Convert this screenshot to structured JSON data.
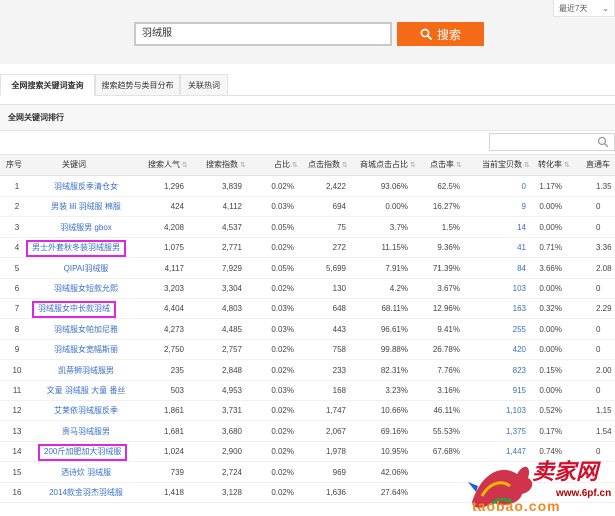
{
  "header": {
    "period": "最近7天",
    "search_value": "羽绒服",
    "search_button": "搜索"
  },
  "tabs": [
    {
      "label": "全网搜索关键词查询",
      "active": true
    },
    {
      "label": "搜索趋势与类目分布",
      "active": false
    },
    {
      "label": "关联热词",
      "active": false
    }
  ],
  "panel": {
    "title": "全网关键词排行"
  },
  "table": {
    "columns": [
      "序号",
      "关键词",
      "搜索人气",
      "搜索指数",
      "占比",
      "点击指数",
      "商城点击占比",
      "点击率",
      "当前宝贝数",
      "转化率",
      "直通车"
    ],
    "rows": [
      [
        "1",
        "羽绒服反季清仓女",
        "1,296",
        "3,839",
        "0.02%",
        "2,422",
        "93.06%",
        "62.5%",
        "0",
        "1.17%",
        "1.35"
      ],
      [
        "2",
        "男装 lili 羽绒服 棉服",
        "424",
        "4,112",
        "0.03%",
        "694",
        "0.00%",
        "16.27%",
        "9",
        "0.00%",
        "0"
      ],
      [
        "3",
        "羽绒服男 gbox",
        "4,208",
        "4,537",
        "0.05%",
        "75",
        "3.7%",
        "1.5%",
        "14",
        "0.00%",
        "0"
      ],
      [
        "4",
        "男士外套秋冬装羽绒服男",
        "1,075",
        "2,771",
        "0.02%",
        "272",
        "11.15%",
        "9.36%",
        "41",
        "0.71%",
        "3.36"
      ],
      [
        "5",
        "QIPAI羽绒服",
        "4,117",
        "7,929",
        "0.05%",
        "5,699",
        "7.91%",
        "71.39%",
        "84",
        "3.66%",
        "2.08"
      ],
      [
        "6",
        "羽绒服女短款允熙",
        "3,203",
        "3,304",
        "0.02%",
        "130",
        "4.2%",
        "3.67%",
        "103",
        "0.00%",
        "0"
      ],
      [
        "7",
        "羽绒服女中长款羽绒",
        "4,404",
        "4,803",
        "0.03%",
        "648",
        "68.11%",
        "12.96%",
        "163",
        "0.32%",
        "2.29"
      ],
      [
        "8",
        "羽绒服女帕加尼雅",
        "4,273",
        "4,485",
        "0.03%",
        "443",
        "96.61%",
        "9.41%",
        "255",
        "0.00%",
        "0"
      ],
      [
        "9",
        "羽绒服女宽幅斯丽",
        "2,750",
        "2,757",
        "0.02%",
        "758",
        "99.88%",
        "26.78%",
        "420",
        "0.00%",
        "0"
      ],
      [
        "10",
        "凯蒂狮羽绒服男",
        "235",
        "2,848",
        "0.02%",
        "233",
        "82.31%",
        "7.76%",
        "823",
        "0.15%",
        "2.00"
      ],
      [
        "11",
        "文童 羽绒服 大童 番丝",
        "503",
        "4,953",
        "0.03%",
        "168",
        "3.23%",
        "3.16%",
        "915",
        "0.00%",
        "0"
      ],
      [
        "12",
        "艾莱依羽绒服反季",
        "1,861",
        "3,731",
        "0.02%",
        "1,747",
        "10.66%",
        "46.11%",
        "1,103",
        "0.52%",
        "1.15"
      ],
      [
        "13",
        "贵马羽绒服男",
        "1,681",
        "3,680",
        "0.02%",
        "2,067",
        "69.16%",
        "55.53%",
        "1,375",
        "0.17%",
        "1.54"
      ],
      [
        "14",
        "200斤加肥加大羽绒服",
        "1,024",
        "2,900",
        "0.02%",
        "1,978",
        "10.95%",
        "67.68%",
        "1,447",
        "0.74%",
        "0"
      ],
      [
        "15",
        "洒诗炊 羽绒服",
        "739",
        "2,724",
        "0.02%",
        "969",
        "42.06%",
        "",
        "",
        "",
        ""
      ],
      [
        "16",
        "2014款金羽杰羽绒服",
        "1,418",
        "3,128",
        "0.02%",
        "1,636",
        "27.64%",
        "",
        "",
        "",
        ""
      ]
    ],
    "highlighted_rows": [
      4,
      7,
      14
    ]
  },
  "watermark": {
    "text": "卖家网",
    "url": "www.6pf.cn",
    "site": "taobao.com"
  },
  "colors": {
    "accent": "#f56a16",
    "link": "#3a6fc4",
    "highlight": "#e026e0"
  },
  "icons": {
    "search": "magnifier-icon",
    "sort": "sort-arrows-icon",
    "dropdown": "chevron-down-icon"
  }
}
